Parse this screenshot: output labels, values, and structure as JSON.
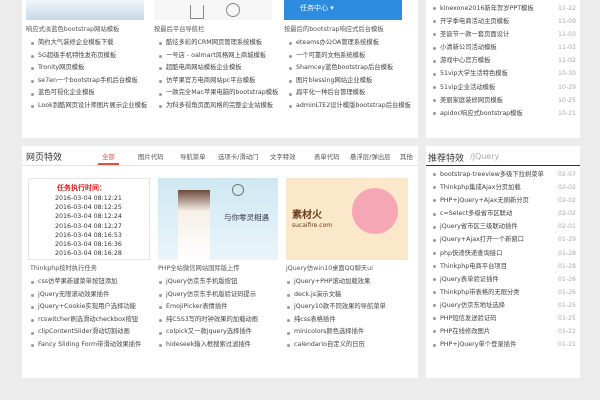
{
  "top": {
    "captions": [
      "响应式淡蓝色bootstrap网站模板",
      "按最后平台导航栏",
      "按最后的bootstrap响应式后台模板"
    ],
    "blue_button": "任务中心",
    "col1": [
      "简约大气装修企业模板下载",
      "5G超级手机特性发布页模板",
      "Tronity网页模板",
      "se7en一个bootstrap手机后台模板",
      "蓝色可视化企业模板",
      "Look到酷网页设计师图片展示企业模板"
    ],
    "col2": [
      "酷炫多彩的CRM网页管理系统模板",
      "一号店 - oalmart风格网上商城模板",
      "超酷电商网站模板企业模板",
      "仿苹果官方电商网站pc平台模板",
      "一款完全Mac苹果电脑的bootstrap模板",
      "为科多视角页面风格的完整企业站模板"
    ],
    "col3": [
      "eteams办公OA管理系统模板",
      "一个可靠的文档系统模板",
      "Shamcey蓝色bootstrap后台模板",
      "图片blessing网站企业模板",
      "扁平化一种后台管理模板",
      "adminLTE2设计模版bootstrap后台模板"
    ]
  },
  "section": {
    "title": "网页特效",
    "tabs": [
      "全部",
      "图片代码",
      "导航菜单",
      "选项卡/滑动门",
      "文字特效",
      "表单代码",
      "悬浮层/弹出层",
      "其他"
    ],
    "countdown_title": "任务执行时间：",
    "countdown_times": [
      "2016-03-04 08:12:21",
      "2016-03-04 08:12:25",
      "2016-03-04 08:12:24",
      "2016-03-04 08:12:27",
      "2016-03-04 08:16:53",
      "2016-03-04 08:16:36",
      "2016-03-04 08:16:28"
    ],
    "banner_text": "与你零灵相遇",
    "material_text": "素材火",
    "material_url": "sucaifire.com",
    "captions": [
      "Thinkphp按时执行任务",
      "PHP全站微信网站国际版上传",
      "jQuery仿win10桌面QQ聊天ui"
    ],
    "col1": [
      "css仿苹果新建菜单按钮添加",
      "jQuery无限滚动效果插件",
      "jQuery+Cookie实现用户选择功能",
      "rcswitcher刷选滑动checkbox按钮",
      "clipContentSlider滑动切割动画",
      "Fancy Sliding Form带滑动效果插件"
    ],
    "col2": [
      "jQuery仿京东手机版按钮",
      "jQuery仿京东手机版验证码提示",
      "EmojiPicker表情插件",
      "纯CSS3写的时钟效果的加载动画",
      "colpick又一款jquery选择插件",
      "hideseek输入框搜索过滤插件"
    ],
    "col3": [
      "jQuery+PHP滚动加载效果",
      "deck.js演示文稿",
      "jQuery10款不同效果的导航菜单",
      "纯css表格插件",
      "minicolors颜色选择插件",
      "calendario自定义的日历"
    ]
  },
  "right_top": {
    "items": [
      {
        "t": "kinexone2016新年贺岁PPT模板",
        "d": "11-22"
      },
      {
        "t": "开学季电商活动主页模板",
        "d": "11-09"
      },
      {
        "t": "圣诞节一款一套页面设计",
        "d": "11-03"
      },
      {
        "t": "小清新公司活动模板",
        "d": "11-02"
      },
      {
        "t": "游戏中心官方模板",
        "d": "11-02"
      },
      {
        "t": "51vip大学生活特色模板",
        "d": "10-30"
      },
      {
        "t": "51vip企业活动模板",
        "d": "10-29"
      },
      {
        "t": "美丽家庭装修网页模板",
        "d": "10-25"
      },
      {
        "t": "apidoc响应式bootstrap模板",
        "d": "10-21"
      }
    ]
  },
  "right_bottom": {
    "title": "推荐特效",
    "subtitle": "/JQuery",
    "items": [
      {
        "t": "bootstrap-treeview多级下拉树菜单",
        "d": "02-07"
      },
      {
        "t": "Thinkphp集成Ajax分页加载",
        "d": "02-02"
      },
      {
        "t": "PHP+jQuery+Ajax无刷新分页",
        "d": "02-02"
      },
      {
        "t": "c=Select多级省市区联动",
        "d": "02-02"
      },
      {
        "t": "jQuery省市区三级联动插件",
        "d": "02-01"
      },
      {
        "t": "jQuery+Ajax打开一个新窗口",
        "d": "01-29"
      },
      {
        "t": "php快递快递查询接口",
        "d": "01-28"
      },
      {
        "t": "Thinkphp电商平台项目",
        "d": "01-28"
      },
      {
        "t": "jQuery表单验证插件",
        "d": "01-26"
      },
      {
        "t": "Thinkphp带表格的无限分类",
        "d": "01-26"
      },
      {
        "t": "jQuery仿京东地址选择",
        "d": "01-25"
      },
      {
        "t": "PHP短信发送验证码",
        "d": "01-25"
      },
      {
        "t": "PHP在线修改图片",
        "d": "01-22"
      },
      {
        "t": "PHP+jQuery单个登录插件",
        "d": "01-21"
      }
    ]
  }
}
